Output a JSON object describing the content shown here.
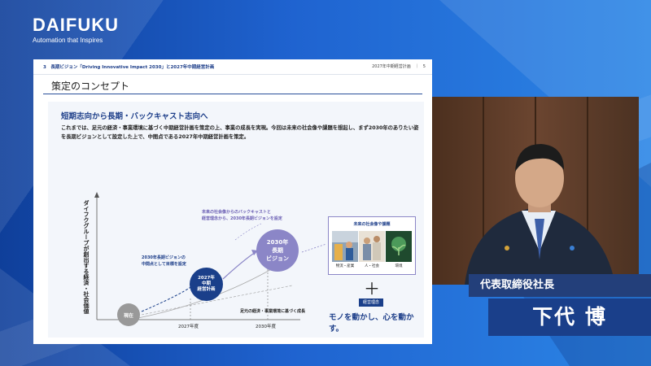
{
  "brand": {
    "logo": "DAIFUKU",
    "tagline": "Automation that Inspires"
  },
  "slide": {
    "breadcrumb": "3　長期ビジョン「Driving Innovative Impact 2030」と2027年中期経営計画",
    "page_info": "2027年中期経営計画　｜　5",
    "title": "策定のコンセプト",
    "subheading": "短期志向から長期・バックキャスト志向へ",
    "description": "これまでは、足元の経済・事業環境に基づく中期経営計画を策定の上、事業の成長を実現。今回は未来の社会像や課題を想起し、まず2030年のありたい姿を長期ビジョンとして設定した上で、中間点である2027年中期経営計画を策定。",
    "chart": {
      "y_axis_label": "ダイフクグループが創出する経済・社会価値",
      "x_ticks": [
        "2027年度",
        "2030年度"
      ],
      "bubble_now": "現在",
      "bubble_mid": [
        "2027年",
        "中期",
        "経営計画"
      ],
      "bubble_vision": [
        "2030年",
        "長期",
        "ビジョン"
      ],
      "note_backcast": [
        "未来の社会像からのバックキャストと",
        "経営理念から、2030年長期ビジョンを設定"
      ],
      "note_midpoint": [
        "2030年長期ビジョンの",
        "中間点として目標を設定"
      ],
      "note_baseline": "足元の経済・事業環境に基づく成長"
    },
    "future_box": {
      "title": "未来の社会像や課題",
      "items": [
        {
          "caption": "物流・産業",
          "icon": "logistics-photo"
        },
        {
          "caption": "人・社会",
          "icon": "people-photo"
        },
        {
          "caption": "環境",
          "icon": "environment-photo"
        }
      ]
    },
    "plus_sign": "＋",
    "philosophy_badge": "経営理念",
    "motto": "モノを動かし、心を動かす。"
  },
  "presenter": {
    "role": "代表取締役社長",
    "name": "下代 博"
  },
  "colors": {
    "navy": "#1a3f8a",
    "purple": "#8b86c7",
    "background_blue": "#1f63d0"
  }
}
